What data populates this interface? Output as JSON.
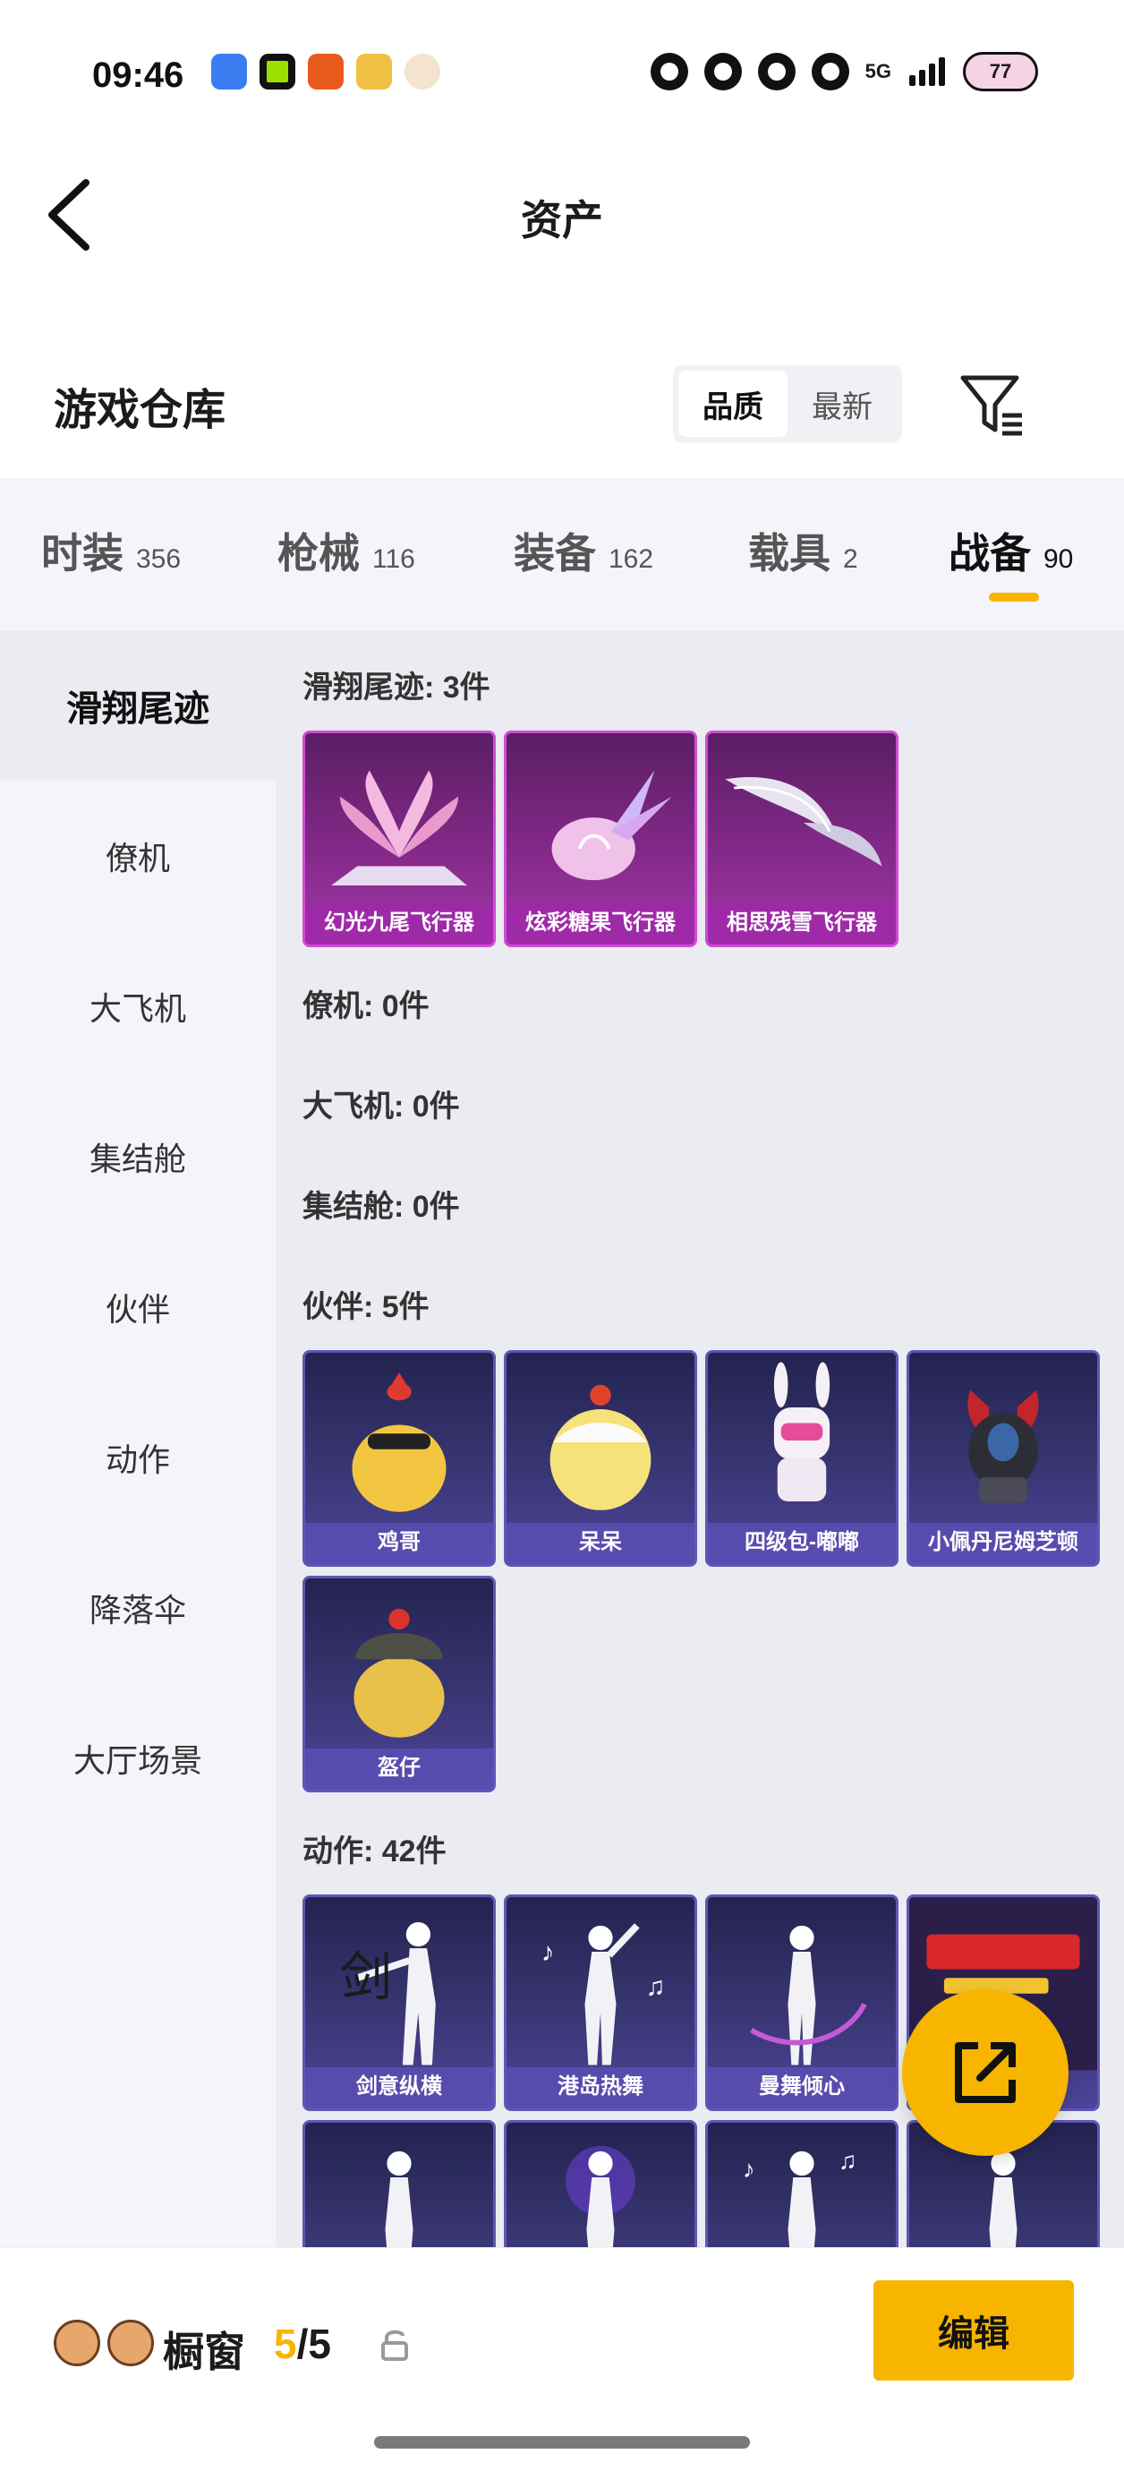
{
  "status_bar": {
    "time": "09:46",
    "network": "5G",
    "battery": "77"
  },
  "header": {
    "title": "资产"
  },
  "warehouse": {
    "title": "游戏仓库",
    "sort_options": [
      "品质",
      "最新"
    ],
    "sort_active": "品质"
  },
  "categories": [
    {
      "label": "时装",
      "count": "356"
    },
    {
      "label": "枪械",
      "count": "116"
    },
    {
      "label": "装备",
      "count": "162"
    },
    {
      "label": "载具",
      "count": "2"
    },
    {
      "label": "战备",
      "count": "90"
    }
  ],
  "active_category": "战备",
  "sidebar": {
    "items": [
      "滑翔尾迹",
      "僚机",
      "大飞机",
      "集结舱",
      "伙伴",
      "动作",
      "降落伞",
      "大厅场景"
    ],
    "active": "滑翔尾迹"
  },
  "sections": [
    {
      "title": "滑翔尾迹: 3件",
      "items": [
        "幻光九尾飞行器",
        "炫彩糖果飞行器",
        "相思残雪飞行器"
      ]
    },
    {
      "title": "僚机: 0件",
      "items": []
    },
    {
      "title": "大飞机: 0件",
      "items": []
    },
    {
      "title": "集结舱: 0件",
      "items": []
    },
    {
      "title": "伙伴: 5件",
      "items": [
        "鸡哥",
        "呆呆",
        "四级包-嘟嘟",
        "小佩丹尼姆芝顿",
        "盔仔"
      ]
    },
    {
      "title": "动作: 42件",
      "items": [
        "剑意纵横",
        "港岛热舞",
        "曼舞倾心"
      ]
    }
  ],
  "bottom_bar": {
    "label": "橱窗",
    "current": "5",
    "separator": "/",
    "total": "5",
    "edit_label": "编辑"
  },
  "colors": {
    "accent": "#f7b500",
    "rare_purple": "#d24bd5",
    "epic_blue": "#6156b6"
  }
}
